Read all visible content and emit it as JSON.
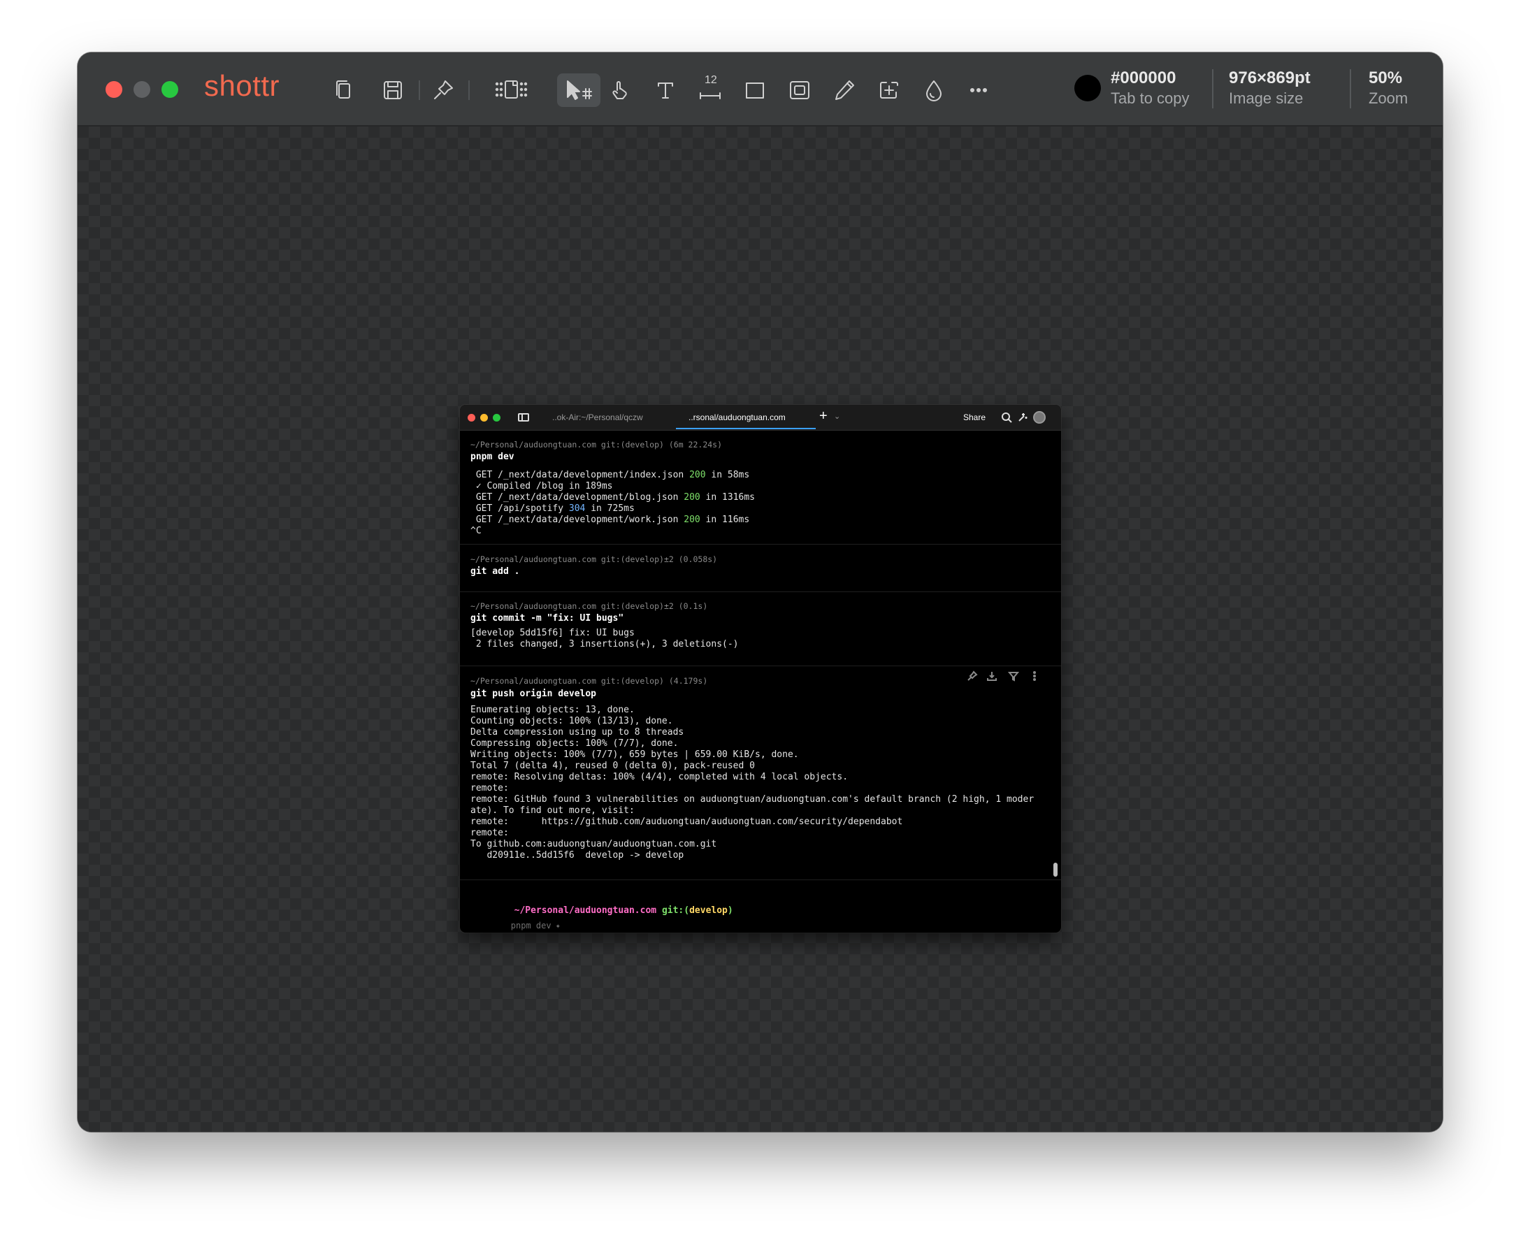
{
  "app": {
    "name": "shottr",
    "brand_color": "#f26a4f"
  },
  "toolbar": {
    "icons": [
      "copy-icon",
      "save-icon",
      "pin-icon",
      "page-layout-icon",
      "select-arrow-icon",
      "hand-icon",
      "text-icon",
      "ruler-icon",
      "rectangle-icon",
      "blur-frame-icon",
      "pen-icon",
      "crop-plus-icon",
      "drop-icon",
      "more-icon"
    ],
    "ruler_number": "12",
    "color": {
      "hex": "#000000",
      "hint": "Tab to copy"
    },
    "image_size": {
      "value": "976×869pt",
      "label": "Image size"
    },
    "zoom": {
      "value": "50%",
      "label": "Zoom"
    }
  },
  "terminal": {
    "tabs": [
      {
        "label": "..ok-Air:~/Personal/qczw",
        "active": false
      },
      {
        "label": "..rsonal/auduongtuan.com",
        "active": true
      }
    ],
    "add_tab": "+",
    "share_label": "Share",
    "blocks": [
      {
        "meta": "~/Personal/auduongtuan.com git:(develop) (6m 22.24s)",
        "command": "pnpm dev",
        "output": [
          [
            " GET /_next/data/development/index.json ",
            {
              "t": "200",
              "c": "g"
            },
            " in 58ms"
          ],
          [
            " ✓ Compiled /blog in 189ms"
          ],
          [
            " GET /_next/data/development/blog.json ",
            {
              "t": "200",
              "c": "g"
            },
            " in 1316ms"
          ],
          [
            " GET /api/spotify ",
            {
              "t": "304",
              "c": "b"
            },
            " in 725ms"
          ],
          [
            " GET /_next/data/development/work.json ",
            {
              "t": "200",
              "c": "g"
            },
            " in 116ms"
          ],
          [
            "^C"
          ]
        ]
      },
      {
        "meta": "~/Personal/auduongtuan.com git:(develop)±2 (0.058s)",
        "command": "git add .",
        "output": []
      },
      {
        "meta": "~/Personal/auduongtuan.com git:(develop)±2 (0.1s)",
        "command": "git commit -m \"fix: UI bugs\"",
        "output": [
          [
            "[develop 5dd15f6] fix: UI bugs"
          ],
          [
            " 2 files changed, 3 insertions(+), 3 deletions(-)"
          ]
        ]
      },
      {
        "meta": "~/Personal/auduongtuan.com git:(develop) (4.179s)",
        "command": "git push origin develop",
        "output": [
          [
            "Enumerating objects: 13, done."
          ],
          [
            "Counting objects: 100% (13/13), done."
          ],
          [
            "Delta compression using up to 8 threads"
          ],
          [
            "Compressing objects: 100% (7/7), done."
          ],
          [
            "Writing objects: 100% (7/7), 659 bytes | 659.00 KiB/s, done."
          ],
          [
            "Total 7 (delta 4), reused 0 (delta 0), pack-reused 0"
          ],
          [
            "remote: Resolving deltas: 100% (4/4), completed with 4 local objects."
          ],
          [
            "remote:"
          ],
          [
            "remote: GitHub found 3 vulnerabilities on auduongtuan/auduongtuan.com's default branch (2 high, 1 moder"
          ],
          [
            "ate). To find out more, visit:"
          ],
          [
            "remote:      https://github.com/auduongtuan/auduongtuan.com/security/dependabot"
          ],
          [
            "remote:"
          ],
          [
            "To github.com:auduongtuan/auduongtuan.com.git"
          ],
          [
            "   d20911e..5dd15f6  develop -> develop"
          ]
        ]
      }
    ],
    "prompt": {
      "path": "~/Personal/auduongtuan.com",
      "git": " git:(",
      "branch": "develop",
      "close": ")",
      "suggestion": "pnpm dev"
    }
  }
}
